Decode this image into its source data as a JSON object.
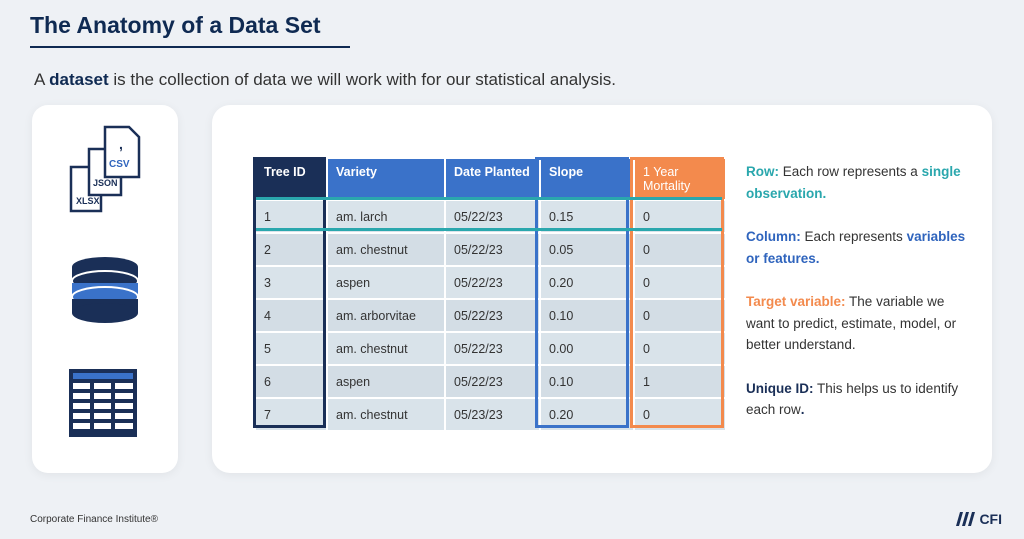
{
  "title": "The Anatomy of a Data Set",
  "intro": {
    "prefix": "A ",
    "highlight": "dataset",
    "suffix": " is the collection of data we will work with for our statistical analysis."
  },
  "file_icons": [
    "CSV",
    "JSON",
    "XLSX"
  ],
  "table": {
    "headers": [
      "Tree ID",
      "Variety",
      "Date Planted",
      "Slope",
      "1 Year Mortality"
    ],
    "rows": [
      [
        "1",
        "am. larch",
        "05/22/23",
        "0.15",
        "0"
      ],
      [
        "2",
        "am. chestnut",
        "05/22/23",
        "0.05",
        "0"
      ],
      [
        "3",
        "aspen",
        "05/22/23",
        "0.20",
        "0"
      ],
      [
        "4",
        "am. arborvitae",
        "05/22/23",
        "0.10",
        "0"
      ],
      [
        "5",
        "am. chestnut",
        "05/22/23",
        "0.00",
        "0"
      ],
      [
        "6",
        "aspen",
        "05/22/23",
        "0.10",
        "1"
      ],
      [
        "7",
        "am. chestnut",
        "05/23/23",
        "0.20",
        "0"
      ]
    ]
  },
  "legend": {
    "row": {
      "label": "Row:",
      "text": " Each row represents a ",
      "em": "single observation."
    },
    "column": {
      "label": "Column:",
      "text": " Each represents ",
      "em": "variables or features."
    },
    "target": {
      "label": "Target variable:",
      "text": " The variable we want to predict, estimate, model, or better understand."
    },
    "unique": {
      "label": "Unique ID:",
      "text": " This helps us to identify each row",
      "em": "."
    }
  },
  "footer": "Corporate Finance Institute®",
  "logo": "CFI",
  "colors": {
    "navy": "#1a2f57",
    "blue": "#3a72c9",
    "orange": "#f38a4d",
    "teal": "#2aa7ad"
  }
}
